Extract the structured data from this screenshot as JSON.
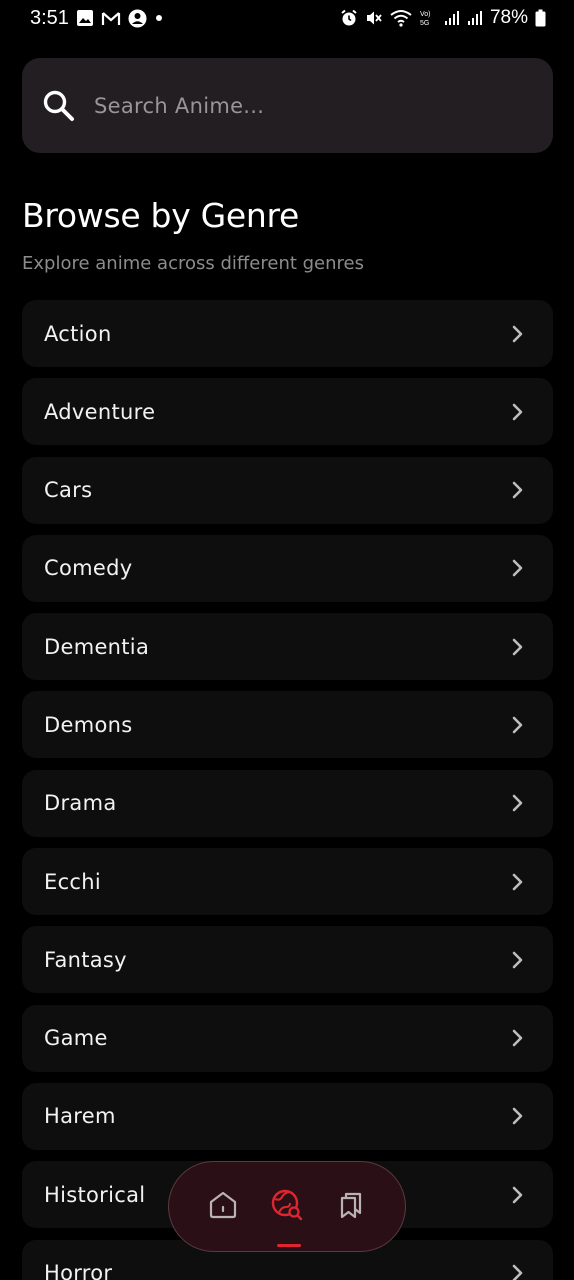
{
  "status_bar": {
    "time": "3:51",
    "battery": "78%",
    "icons_left": [
      "image-icon",
      "gmail-icon",
      "account-icon",
      "dot-icon"
    ],
    "icons_right": [
      "alarm-icon",
      "mute-icon",
      "wifi-icon",
      "volte-5g-icon",
      "signal-icon",
      "signal-icon",
      "battery-icon"
    ]
  },
  "search": {
    "placeholder": "Search Anime..."
  },
  "header": {
    "title": "Browse by Genre",
    "subtitle": "Explore anime across different genres"
  },
  "genres": [
    {
      "label": "Action"
    },
    {
      "label": "Adventure"
    },
    {
      "label": "Cars"
    },
    {
      "label": "Comedy"
    },
    {
      "label": "Dementia"
    },
    {
      "label": "Demons"
    },
    {
      "label": "Drama"
    },
    {
      "label": "Ecchi"
    },
    {
      "label": "Fantasy"
    },
    {
      "label": "Game"
    },
    {
      "label": "Harem"
    },
    {
      "label": "Historical"
    },
    {
      "label": "Horror"
    }
  ],
  "bottom_nav": {
    "items": [
      "home-icon",
      "explore-icon",
      "bookmarks-icon"
    ],
    "active": "explore-icon"
  },
  "colors": {
    "background": "#000000",
    "card": "#0e0e0e",
    "search_bg": "#231e21",
    "accent": "#e1252f"
  }
}
